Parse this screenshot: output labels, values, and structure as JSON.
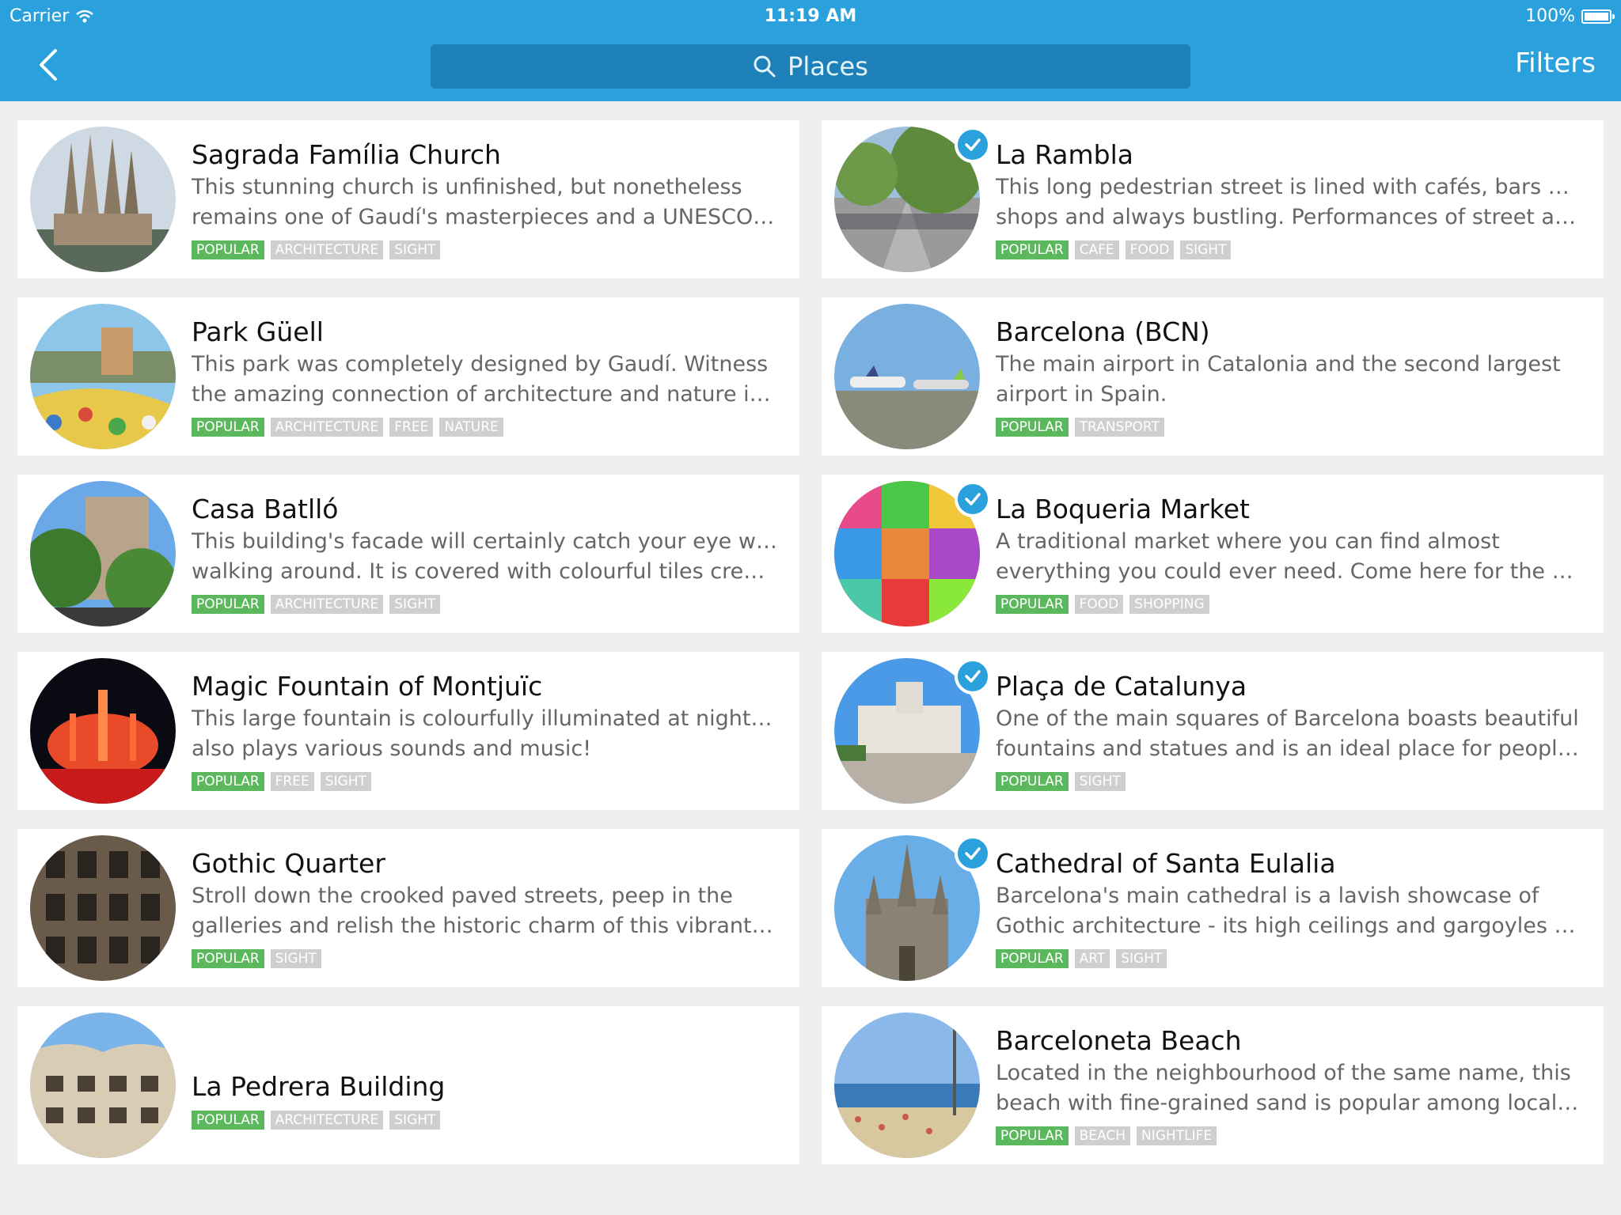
{
  "status": {
    "carrier": "Carrier",
    "time": "11:19 AM",
    "battery": "100%"
  },
  "nav": {
    "search_placeholder": "Places",
    "filters_label": "Filters"
  },
  "places": [
    {
      "title": "Sagrada Família Church",
      "desc1": "This stunning church is unfinished, but nonetheless",
      "desc2": "remains one of Gaudí's masterpieces and a UNESCO…",
      "tags": [
        "POPULAR",
        "ARCHITECTURE",
        "SIGHT"
      ],
      "checked": false,
      "col": 0,
      "row": 0,
      "thumb": "spires"
    },
    {
      "title": "La Rambla",
      "desc1": "This long pedestrian street is lined with cafés, bars and",
      "desc2": "shops and always bustling. Performances of street arti…",
      "tags": [
        "POPULAR",
        "CAFE",
        "FOOD",
        "SIGHT"
      ],
      "checked": true,
      "col": 1,
      "row": 0,
      "thumb": "street"
    },
    {
      "title": "Park Güell",
      "desc1": "This park was completely designed by Gaudí. Witness",
      "desc2": "the amazing connection of architecture and nature ins…",
      "tags": [
        "POPULAR",
        "ARCHITECTURE",
        "FREE",
        "NATURE"
      ],
      "checked": false,
      "col": 0,
      "row": 1,
      "thumb": "mosaic"
    },
    {
      "title": "Barcelona (BCN)",
      "desc1": "The main airport in Catalonia and the second largest",
      "desc2": "airport in Spain.",
      "tags": [
        "POPULAR",
        "TRANSPORT"
      ],
      "checked": false,
      "col": 1,
      "row": 1,
      "thumb": "airport"
    },
    {
      "title": "Casa Batlló",
      "desc1": "This building's facade will certainly catch your eye while",
      "desc2": "walking around. It is covered with colourful tiles creati…",
      "tags": [
        "POPULAR",
        "ARCHITECTURE",
        "SIGHT"
      ],
      "checked": false,
      "col": 0,
      "row": 2,
      "thumb": "trees"
    },
    {
      "title": "La Boqueria Market",
      "desc1": "A traditional market where you can find almost",
      "desc2": "everything you could ever need. Come here for the s…",
      "tags": [
        "POPULAR",
        "FOOD",
        "SHOPPING"
      ],
      "checked": true,
      "col": 1,
      "row": 2,
      "thumb": "candy"
    },
    {
      "title": "Magic Fountain of Montjuïc",
      "desc1": "This large fountain is colourfully illuminated at night. It",
      "desc2": "also plays various sounds and music!",
      "tags": [
        "POPULAR",
        "FREE",
        "SIGHT"
      ],
      "checked": false,
      "col": 0,
      "row": 3,
      "thumb": "fountain"
    },
    {
      "title": "Plaça de Catalunya",
      "desc1": "One of the main squares of Barcelona boasts beautiful",
      "desc2": "fountains and statues and is an ideal place for people…",
      "tags": [
        "POPULAR",
        "SIGHT"
      ],
      "checked": true,
      "col": 1,
      "row": 3,
      "thumb": "square"
    },
    {
      "title": "Gothic Quarter",
      "desc1": "Stroll down the crooked paved streets, peep in the",
      "desc2": "galleries and relish the historic charm of this vibrant q…",
      "tags": [
        "POPULAR",
        "SIGHT"
      ],
      "checked": false,
      "col": 0,
      "row": 4,
      "thumb": "facade"
    },
    {
      "title": "Cathedral of Santa Eulalia",
      "desc1": "Barcelona's main cathedral is a lavish showcase of",
      "desc2": "Gothic architecture - its high ceilings and gargoyles ar…",
      "tags": [
        "POPULAR",
        "ART",
        "SIGHT"
      ],
      "checked": true,
      "col": 1,
      "row": 4,
      "thumb": "cathedral"
    },
    {
      "title": "La Pedrera Building",
      "desc1": "",
      "desc2": "",
      "tags": [
        "POPULAR",
        "ARCHITECTURE",
        "SIGHT"
      ],
      "checked": false,
      "col": 0,
      "row": 5,
      "thumb": "pedrera"
    },
    {
      "title": "Barceloneta Beach",
      "desc1": "Located in the neighbourhood of the same name, this",
      "desc2": "beach with fine-grained sand is popular among locals…",
      "tags": [
        "POPULAR",
        "BEACH",
        "NIGHTLIFE"
      ],
      "checked": false,
      "col": 1,
      "row": 5,
      "thumb": "beach"
    }
  ],
  "colors": {
    "bar": "#2aa1dc",
    "search": "#1d80b8",
    "popular": "#5cb85c",
    "tag": "#cfcfcf"
  }
}
